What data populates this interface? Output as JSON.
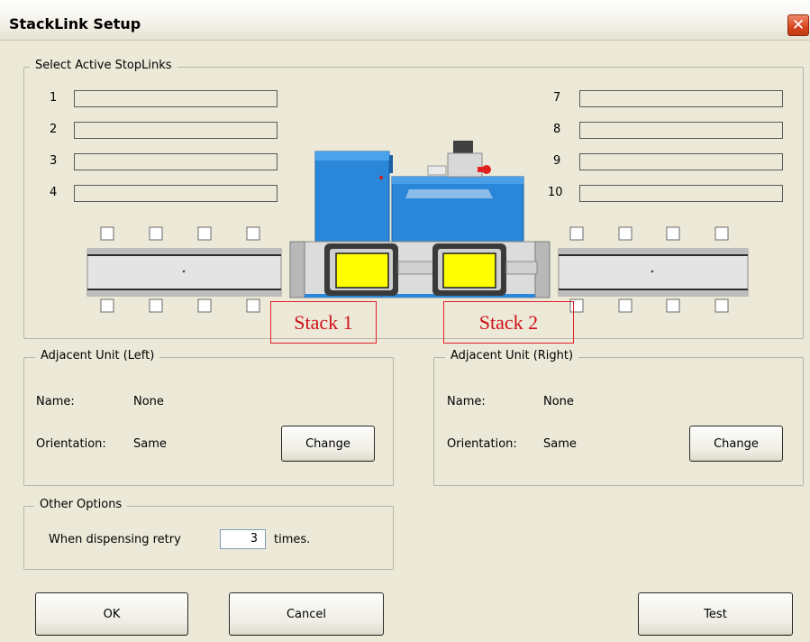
{
  "window": {
    "title": "StackLink Setup"
  },
  "stoplinks": {
    "legend": "Select Active StopLinks",
    "left": [
      "1",
      "2",
      "3",
      "4"
    ],
    "right": [
      "7",
      "8",
      "9",
      "10"
    ]
  },
  "stacks": {
    "stack1": "Stack 1",
    "stack2": "Stack 2"
  },
  "adjacent_left": {
    "legend": "Adjacent Unit (Left)",
    "name_label": "Name:",
    "name_value": "None",
    "orientation_label": "Orientation:",
    "orientation_value": "Same",
    "change": "Change"
  },
  "adjacent_right": {
    "legend": "Adjacent Unit (Right)",
    "name_label": "Name:",
    "name_value": "None",
    "orientation_label": "Orientation:",
    "orientation_value": "Same",
    "change": "Change"
  },
  "other_options": {
    "legend": "Other Options",
    "prefix": "When dispensing retry",
    "value": "3",
    "suffix": "times."
  },
  "buttons": {
    "ok": "OK",
    "cancel": "Cancel",
    "test": "Test"
  },
  "colors": {
    "machine_blue": "#2a86d8",
    "tray_yellow": "#ffff00",
    "highlight_red": "#e0202a"
  }
}
